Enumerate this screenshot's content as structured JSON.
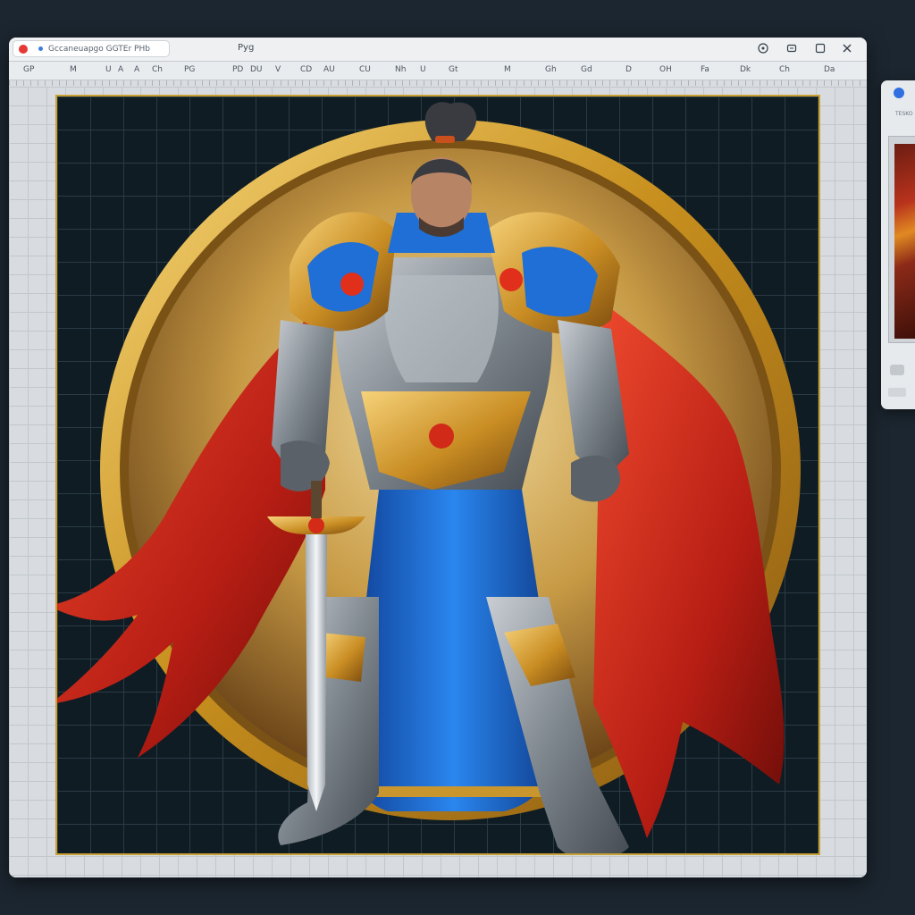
{
  "window": {
    "tab_title": "Gccaneuapgo GGTEr  PHb",
    "center_title": "Pyg",
    "controls": {
      "help": "?",
      "minimize": "▢",
      "maximize": "□",
      "close": "✕"
    }
  },
  "toolbar": {
    "items": [
      "GP",
      "M",
      "U",
      "A",
      "A",
      "Ch",
      "PG",
      "PD",
      "DU",
      "V",
      "CD",
      "AU",
      "CU",
      "Nh",
      "U",
      "Gt",
      "M",
      "Gh",
      "Gd",
      "D",
      "OH",
      "Fa",
      "Dk",
      "Ch",
      "Da"
    ]
  },
  "artboard": {
    "frame_color": "#c8a033",
    "background_color": "#0f1c24",
    "illustration": "armored-knight-with-red-cape-and-sword-on-gold-medallion"
  },
  "side_panel": {
    "label": "TESKO"
  },
  "colors": {
    "gold": "#d9a83a",
    "cape_red": "#c8281c",
    "robe_blue": "#1f6fd6",
    "armor_silver": "#8e969e"
  }
}
